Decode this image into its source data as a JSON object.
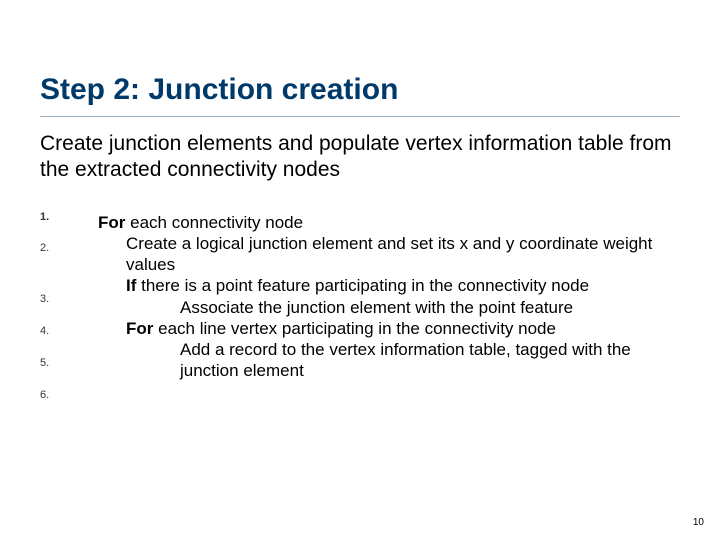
{
  "title": "Step 2: Junction creation",
  "subtitle": "Create junction elements and populate vertex information table from the extracted connectivity nodes",
  "nums": [
    "1.",
    "2.",
    "3.",
    "4.",
    "5.",
    "6."
  ],
  "kw": {
    "for": "For",
    "if": "If"
  },
  "lines": {
    "l1_after_for": " each connectivity node",
    "l2": "Create a logical junction element and set its x and y coordinate weight values",
    "l3_after_if": " there is a point feature participating in the connectivity node",
    "l4": "Associate the junction element with the point feature",
    "l5_after_for": " each line vertex participating in the connectivity node",
    "l6": "Add a record to the vertex information table, tagged with the junction element"
  },
  "page_number": "10"
}
